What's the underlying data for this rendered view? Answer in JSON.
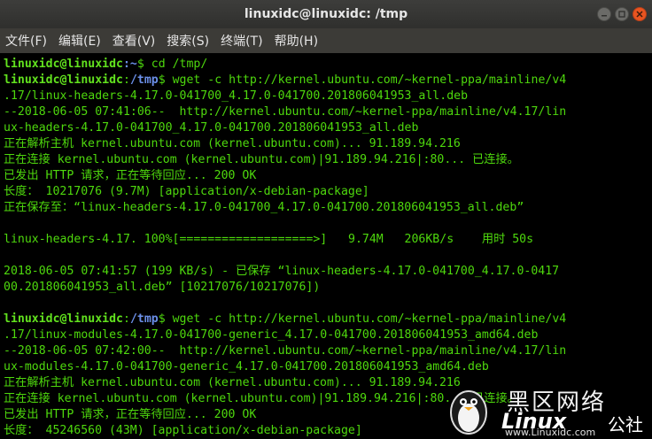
{
  "window": {
    "title": "linuxidc@linuxidc: /tmp",
    "controls": [
      "minimize-icon",
      "maximize-icon",
      "close-icon"
    ]
  },
  "menu": [
    "文件(F)",
    "编辑(E)",
    "查看(V)",
    "搜索(S)",
    "终端(T)",
    "帮助(H)"
  ],
  "colors": {
    "output_green": "#4ed80d",
    "prompt_user": "#62e21e",
    "prompt_path": "#6b8fe8",
    "close_button": "#e95420"
  },
  "terminal": {
    "prompt_user": "linuxidc@linuxidc",
    "line1_path": ":~",
    "line1_cmd": "$ cd /tmp/",
    "line2_path": "/tmp",
    "line2_cmd": "$ wget -c http://kernel.ubuntu.com/~kernel-ppa/mainline/v4",
    "line3": ".17/linux-headers-4.17.0-041700_4.17.0-041700.201806041953_all.deb",
    "line4": "--2018-06-05 07:41:06--  http://kernel.ubuntu.com/~kernel-ppa/mainline/v4.17/lin",
    "line5": "ux-headers-4.17.0-041700_4.17.0-041700.201806041953_all.deb",
    "line6": "正在解析主机 kernel.ubuntu.com (kernel.ubuntu.com)... 91.189.94.216",
    "line7": "正在连接 kernel.ubuntu.com (kernel.ubuntu.com)|91.189.94.216|:80... 已连接。",
    "line8": "已发出 HTTP 请求，正在等待回应... 200 OK",
    "line9": "长度： 10217076 (9.7M) [application/x-debian-package]",
    "line10": "正在保存至：“linux-headers-4.17.0-041700_4.17.0-041700.201806041953_all.deb”",
    "line11": "linux-headers-4.17. 100%[===================>]   9.74M   206KB/s    用时 50s",
    "line12": "2018-06-05 07:41:57 (199 KB/s) - 已保存 “linux-headers-4.17.0-041700_4.17.0-0417",
    "line13": "00.201806041953_all.deb” [10217076/10217076])",
    "line14_path": "/tmp",
    "line14_cmd": "$ wget -c http://kernel.ubuntu.com/~kernel-ppa/mainline/v4",
    "line15": ".17/linux-modules-4.17.0-041700-generic_4.17.0-041700.201806041953_amd64.deb",
    "line16": "--2018-06-05 07:42:00--  http://kernel.ubuntu.com/~kernel-ppa/mainline/v4.17/lin",
    "line17": "ux-modules-4.17.0-041700-generic_4.17.0-041700.201806041953_amd64.deb",
    "line18": "正在解析主机 kernel.ubuntu.com (kernel.ubuntu.com)... 91.189.94.216",
    "line19": "正在连接 kernel.ubuntu.com (kernel.ubuntu.com)|91.189.94.216|:80... 已连接。",
    "line20": "已发出 HTTP 请求，正在等待回应... 200 OK",
    "line21": "长度： 45246560 (43M) [application/x-debian-package]"
  },
  "watermark": {
    "cn": "黑区网络",
    "brand": "Linux",
    "she": "公社",
    "url": "www.Linuxidc.com"
  }
}
